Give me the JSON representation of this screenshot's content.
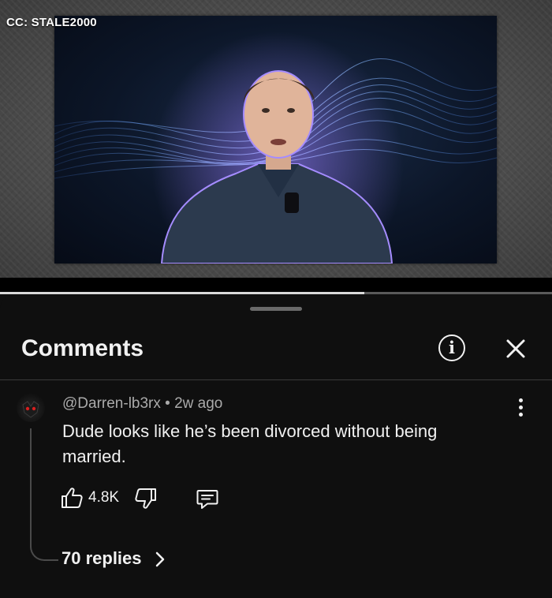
{
  "video": {
    "cc_label": "CC: STALE2000",
    "progress": 0.66
  },
  "comments_panel": {
    "title": "Comments"
  },
  "comment": {
    "author": "@Darren-lb3rx",
    "separator": "•",
    "time_ago": "2w ago",
    "text": "Dude looks like he’s been divorced without being married.",
    "likes": "4.8K",
    "replies_label": "70 replies"
  },
  "icons": {
    "info": "info-circle-icon",
    "close": "close-x-icon",
    "more": "vertical-ellipsis-icon",
    "like": "thumbs-up-icon",
    "dislike": "thumbs-down-icon",
    "reply": "reply-comment-icon",
    "replies_chevron": "chevron-right-icon"
  },
  "colors": {
    "background": "#0f0f0f",
    "text_primary": "#f1f1f1",
    "text_secondary": "#aaaaaa",
    "divider": "#3a3a3a"
  }
}
